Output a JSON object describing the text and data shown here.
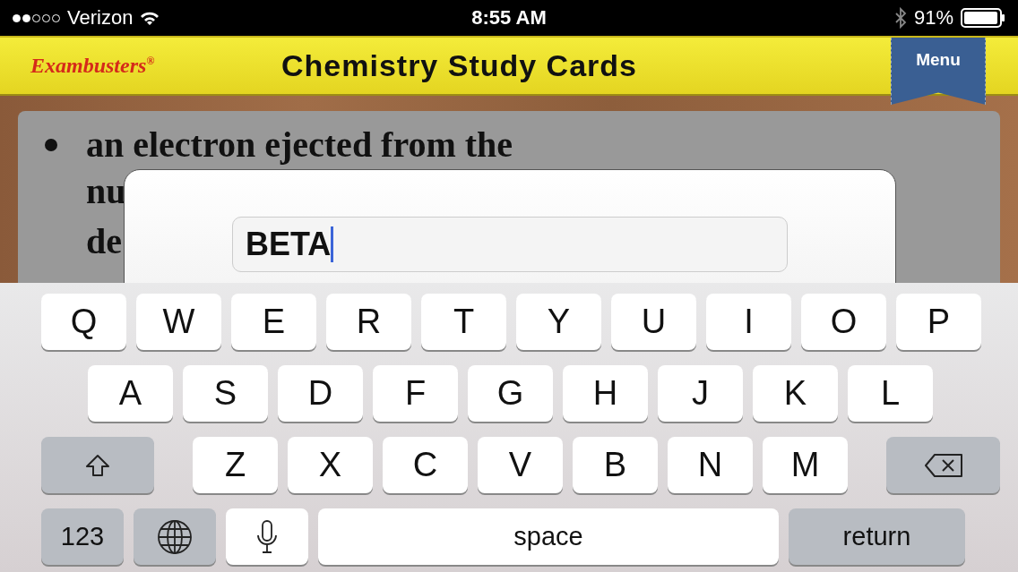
{
  "status_bar": {
    "carrier": "Verizon",
    "time": "8:55 AM",
    "battery": "91%"
  },
  "header": {
    "logo": "Exambusters",
    "logo_mark": "®",
    "title": "Chemistry Study Cards",
    "menu": "Menu"
  },
  "card": {
    "lines": [
      "an electron ejected from the",
      "nu",
      "de"
    ]
  },
  "dialog": {
    "input": {
      "value": "BETA",
      "focused": true
    }
  },
  "keyboard": {
    "rows": [
      [
        {
          "kind": "letter",
          "label": "Q"
        },
        {
          "kind": "letter",
          "label": "W"
        },
        {
          "kind": "letter",
          "label": "E"
        },
        {
          "kind": "letter",
          "label": "R"
        },
        {
          "kind": "letter",
          "label": "T"
        },
        {
          "kind": "letter",
          "label": "Y"
        },
        {
          "kind": "letter",
          "label": "U"
        },
        {
          "kind": "letter",
          "label": "I"
        },
        {
          "kind": "letter",
          "label": "O"
        },
        {
          "kind": "letter",
          "label": "P"
        }
      ],
      [
        {
          "kind": "letter",
          "label": "A"
        },
        {
          "kind": "letter",
          "label": "S"
        },
        {
          "kind": "letter",
          "label": "D"
        },
        {
          "kind": "letter",
          "label": "F"
        },
        {
          "kind": "letter",
          "label": "G"
        },
        {
          "kind": "letter",
          "label": "H"
        },
        {
          "kind": "letter",
          "label": "J"
        },
        {
          "kind": "letter",
          "label": "K"
        },
        {
          "kind": "letter",
          "label": "L"
        }
      ],
      [
        {
          "kind": "shift"
        },
        {
          "kind": "letter",
          "label": "Z"
        },
        {
          "kind": "letter",
          "label": "X"
        },
        {
          "kind": "letter",
          "label": "C"
        },
        {
          "kind": "letter",
          "label": "V"
        },
        {
          "kind": "letter",
          "label": "B"
        },
        {
          "kind": "letter",
          "label": "N"
        },
        {
          "kind": "letter",
          "label": "M"
        },
        {
          "kind": "delete"
        }
      ],
      [
        {
          "kind": "mode",
          "label": "123"
        },
        {
          "kind": "globe"
        },
        {
          "kind": "mic"
        },
        {
          "kind": "space",
          "label": "space"
        },
        {
          "kind": "return",
          "label": "return"
        }
      ]
    ]
  }
}
